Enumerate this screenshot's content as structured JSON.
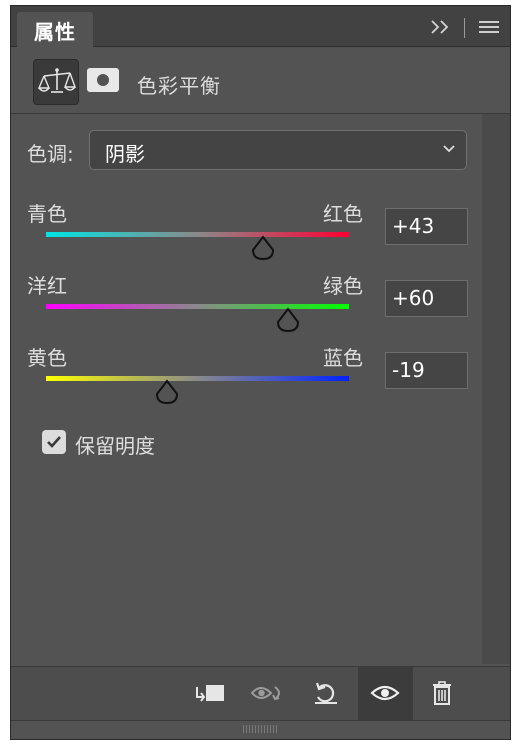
{
  "tab": {
    "label": "属性"
  },
  "header": {
    "title": "色彩平衡"
  },
  "tone": {
    "label": "色调:",
    "value": "阴影"
  },
  "sliders": [
    {
      "left_label": "青色",
      "right_label": "红色",
      "value": "+43",
      "fraction": 0.715,
      "colors": [
        "#00e5e5",
        "#ff0033"
      ]
    },
    {
      "left_label": "洋红",
      "right_label": "绿色",
      "value": "+60",
      "fraction": 0.8,
      "colors": [
        "#ff00ff",
        "#00ff00"
      ]
    },
    {
      "left_label": "黄色",
      "right_label": "蓝色",
      "value": "-19",
      "fraction": 0.4,
      "colors": [
        "#ffff00",
        "#0022ff"
      ]
    }
  ],
  "preserve_luminosity": {
    "label": "保留明度",
    "checked": true
  },
  "icons": {
    "tab_expand": "double-chevron-right-icon",
    "tab_menu": "hamburger-menu-icon",
    "adjustment": "balance-scale-icon",
    "mask": "layer-mask-icon",
    "clip": "clip-to-layer-icon",
    "view_previous": "view-previous-state-icon",
    "reset": "reset-icon",
    "visibility": "eye-icon",
    "delete": "trash-icon"
  },
  "tab_expand_glyph": "»"
}
